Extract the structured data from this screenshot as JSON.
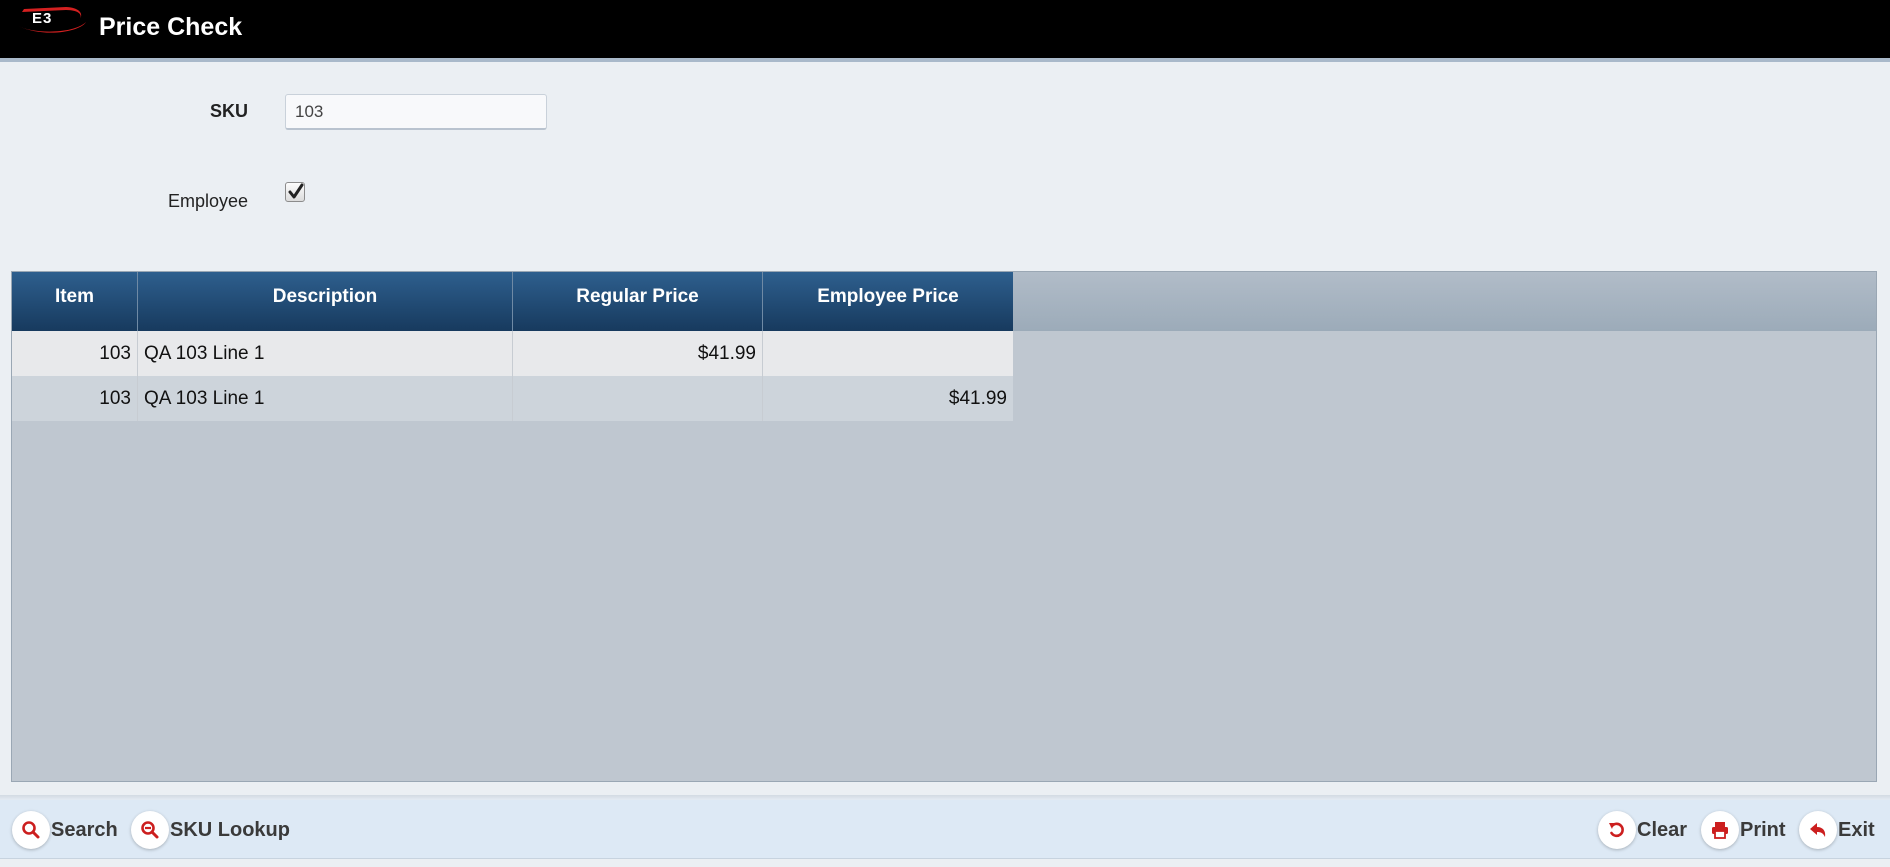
{
  "header": {
    "title": "Price Check"
  },
  "form": {
    "sku_label": "SKU",
    "sku_value": "103",
    "employee_label": "Employee",
    "employee_checked": true
  },
  "grid": {
    "columns": [
      "Item",
      "Description",
      "Regular Price",
      "Employee Price"
    ],
    "rows": [
      {
        "item": "103",
        "description": "QA 103 Line 1",
        "regular_price": "$41.99",
        "employee_price": ""
      },
      {
        "item": "103",
        "description": "QA 103 Line 1",
        "regular_price": "",
        "employee_price": "$41.99"
      }
    ]
  },
  "toolbar": {
    "search_label": "Search",
    "sku_lookup_label": "SKU Lookup",
    "clear_label": "Clear",
    "print_label": "Print",
    "exit_label": "Exit"
  },
  "colors": {
    "accent": "#cc1f1f",
    "header_bg": "#000000",
    "grid_header": "#1f4a74"
  },
  "icons": {
    "search": "magnifier-icon",
    "sku_lookup": "magnifier-minus-icon",
    "clear": "undo-icon",
    "print": "printer-icon",
    "exit": "reply-arrow-icon"
  }
}
